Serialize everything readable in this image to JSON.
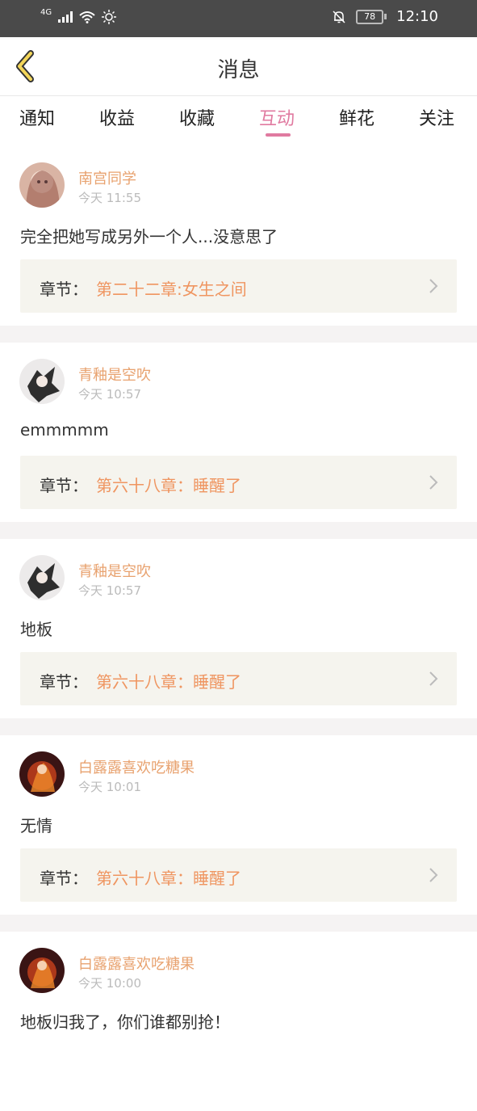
{
  "status_bar": {
    "network": "4G",
    "battery": "78",
    "time": "12:10"
  },
  "header": {
    "title": "消息"
  },
  "tabs": [
    {
      "label": "通知"
    },
    {
      "label": "收益"
    },
    {
      "label": "收藏"
    },
    {
      "label": "互动",
      "active": true
    },
    {
      "label": "鲜花"
    },
    {
      "label": "关注"
    }
  ],
  "chapter_label": "章节：",
  "messages": [
    {
      "user": "南宫同学",
      "time": "今天 11:55",
      "text": "完全把她写成另外一个人...没意思了",
      "chapter": "第二十二章:女生之间"
    },
    {
      "user": "青釉是空吹",
      "time": "今天 10:57",
      "text": "emmmmm",
      "chapter": "第六十八章：睡醒了"
    },
    {
      "user": "青釉是空吹",
      "time": "今天 10:57",
      "text": "地板",
      "chapter": "第六十八章：睡醒了"
    },
    {
      "user": "白露露喜欢吃糖果",
      "time": "今天 10:01",
      "text": "无情",
      "chapter": "第六十八章：睡醒了"
    },
    {
      "user": "白露露喜欢吃糖果",
      "time": "今天 10:00",
      "text": "地板归我了，你们谁都别抢！",
      "chapter": ""
    }
  ],
  "colors": {
    "accent": "#e07aa0",
    "username": "#e8a26f",
    "chapter_title": "#ef9560",
    "status_bar": "#4a4a4a"
  }
}
